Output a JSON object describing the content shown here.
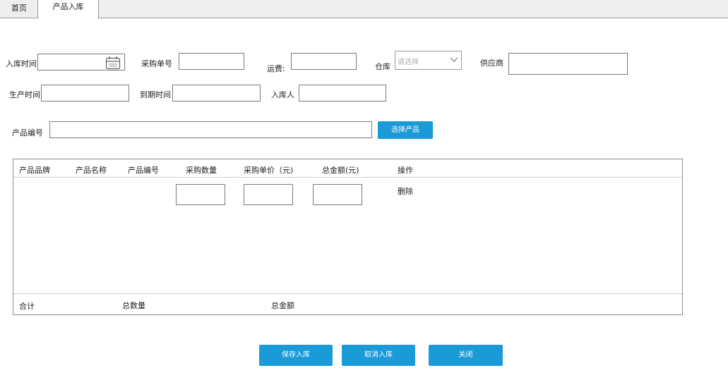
{
  "tabs": [
    {
      "label": "首页",
      "active": false
    },
    {
      "label": "产品入库",
      "active": true
    }
  ],
  "form": {
    "stock_in_time": {
      "label": "入库时间",
      "value": ""
    },
    "purchase_no": {
      "label": "采购单号",
      "value": ""
    },
    "freight": {
      "label": "运费:",
      "value": ""
    },
    "warehouse": {
      "label": "仓库",
      "placeholder": "请选择"
    },
    "supplier": {
      "label": "供应商",
      "value": ""
    },
    "production_time": {
      "label": "生产时间",
      "value": ""
    },
    "expiry_time": {
      "label": "到期时间",
      "value": ""
    },
    "stock_in_person": {
      "label": "入库人",
      "value": ""
    },
    "product_code": {
      "label": "产品编号",
      "value": ""
    },
    "select_product_button": "选择产品"
  },
  "table": {
    "columns": [
      "产品品牌",
      "产品名称",
      "产品编号",
      "采购数量",
      "采购单价（元)",
      "总金额(元)",
      "操作"
    ],
    "row": {
      "delete_label": "删除",
      "quantity": "",
      "unit_price": "",
      "total": ""
    },
    "footer": {
      "total_label": "合计",
      "total_qty_label": "总数量",
      "total_amount_label": "总金额"
    }
  },
  "actions": {
    "save": "保存入库",
    "cancel": "取消入库",
    "close": "关闭"
  },
  "colors": {
    "accent": "#1a9bd7",
    "tab_bg": "#eeeeee",
    "border": "#7a7a7a"
  },
  "icons": {
    "date_picker": "calendar-icon",
    "dropdown": "chevron-down-icon"
  }
}
